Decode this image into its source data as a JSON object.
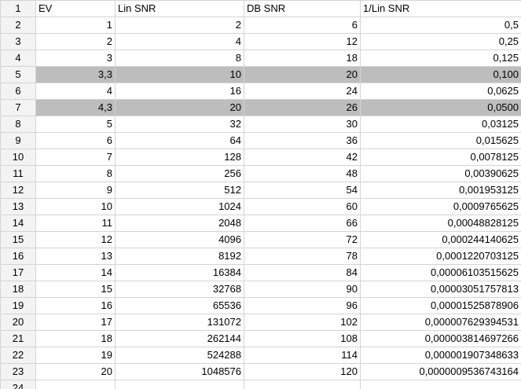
{
  "header_row": {
    "num": "1",
    "cells": [
      "EV",
      "Lin SNR",
      "DB SNR",
      "1/Lin SNR"
    ]
  },
  "rows": [
    {
      "num": "2",
      "ev": "1",
      "lin": "2",
      "db": "6",
      "inv": "0,5",
      "selected": false
    },
    {
      "num": "3",
      "ev": "2",
      "lin": "4",
      "db": "12",
      "inv": "0,25",
      "selected": false
    },
    {
      "num": "4",
      "ev": "3",
      "lin": "8",
      "db": "18",
      "inv": "0,125",
      "selected": false
    },
    {
      "num": "5",
      "ev": "3,3",
      "lin": "10",
      "db": "20",
      "inv": "0,100",
      "selected": true
    },
    {
      "num": "6",
      "ev": "4",
      "lin": "16",
      "db": "24",
      "inv": "0,0625",
      "selected": false
    },
    {
      "num": "7",
      "ev": "4,3",
      "lin": "20",
      "db": "26",
      "inv": "0,0500",
      "selected": true
    },
    {
      "num": "8",
      "ev": "5",
      "lin": "32",
      "db": "30",
      "inv": "0,03125",
      "selected": false
    },
    {
      "num": "9",
      "ev": "6",
      "lin": "64",
      "db": "36",
      "inv": "0,015625",
      "selected": false
    },
    {
      "num": "10",
      "ev": "7",
      "lin": "128",
      "db": "42",
      "inv": "0,0078125",
      "selected": false
    },
    {
      "num": "11",
      "ev": "8",
      "lin": "256",
      "db": "48",
      "inv": "0,00390625",
      "selected": false
    },
    {
      "num": "12",
      "ev": "9",
      "lin": "512",
      "db": "54",
      "inv": "0,001953125",
      "selected": false
    },
    {
      "num": "13",
      "ev": "10",
      "lin": "1024",
      "db": "60",
      "inv": "0,0009765625",
      "selected": false
    },
    {
      "num": "14",
      "ev": "11",
      "lin": "2048",
      "db": "66",
      "inv": "0,00048828125",
      "selected": false
    },
    {
      "num": "15",
      "ev": "12",
      "lin": "4096",
      "db": "72",
      "inv": "0,000244140625",
      "selected": false
    },
    {
      "num": "16",
      "ev": "13",
      "lin": "8192",
      "db": "78",
      "inv": "0,0001220703125",
      "selected": false
    },
    {
      "num": "17",
      "ev": "14",
      "lin": "16384",
      "db": "84",
      "inv": "0,00006103515625",
      "selected": false
    },
    {
      "num": "18",
      "ev": "15",
      "lin": "32768",
      "db": "90",
      "inv": "0,00003051757813",
      "selected": false
    },
    {
      "num": "19",
      "ev": "16",
      "lin": "65536",
      "db": "96",
      "inv": "0,00001525878906",
      "selected": false
    },
    {
      "num": "20",
      "ev": "17",
      "lin": "131072",
      "db": "102",
      "inv": "0,000007629394531",
      "selected": false
    },
    {
      "num": "21",
      "ev": "18",
      "lin": "262144",
      "db": "108",
      "inv": "0,000003814697266",
      "selected": false
    },
    {
      "num": "22",
      "ev": "19",
      "lin": "524288",
      "db": "114",
      "inv": "0,000001907348633",
      "selected": false
    },
    {
      "num": "23",
      "ev": "20",
      "lin": "1048576",
      "db": "120",
      "inv": "0,0000009536743164",
      "selected": false
    }
  ],
  "partial_row": {
    "num": "24"
  }
}
